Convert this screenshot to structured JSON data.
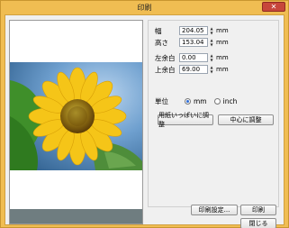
{
  "window": {
    "title": "印刷",
    "close_symbol": "✕"
  },
  "fields": [
    {
      "label": "幅",
      "value": "204.05",
      "unit": "mm"
    },
    {
      "label": "高さ",
      "value": "153.04",
      "unit": "mm"
    },
    {
      "label": "左余白",
      "value": "0.00",
      "unit": "mm"
    },
    {
      "label": "上余白",
      "value": "69.00",
      "unit": "mm"
    }
  ],
  "units": {
    "label": "単位",
    "options": [
      "mm",
      "inch"
    ],
    "selected": "mm"
  },
  "buttons": {
    "fit_paper": "用紙いっぱいに調整",
    "center": "中心に調整",
    "print_settings": "印刷設定...",
    "print": "印刷",
    "close": "閉じる"
  },
  "icons": {
    "spin_up": "▲",
    "spin_down": "▼"
  },
  "colors": {
    "title_bar": "#f0bd52",
    "close_button": "#c7463b",
    "radio_selected": "#2d6cd6"
  }
}
